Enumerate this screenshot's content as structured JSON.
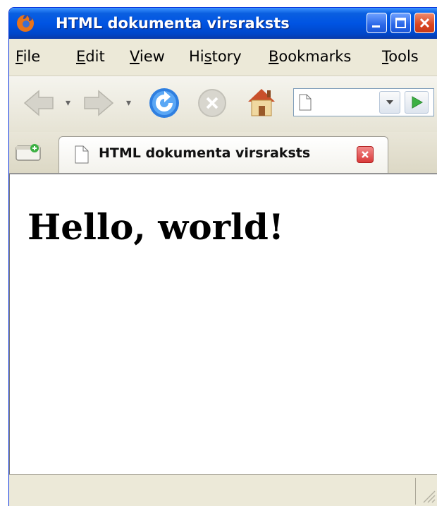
{
  "window": {
    "title": "HTML dokumenta virsraksts"
  },
  "menu": {
    "items": [
      {
        "pre": "",
        "ul": "F",
        "post": "ile"
      },
      {
        "pre": "",
        "ul": "E",
        "post": "dit"
      },
      {
        "pre": "",
        "ul": "V",
        "post": "iew"
      },
      {
        "pre": "Hi",
        "ul": "s",
        "post": "tory"
      },
      {
        "pre": "",
        "ul": "B",
        "post": "ookmarks"
      },
      {
        "pre": "",
        "ul": "T",
        "post": "ools"
      }
    ]
  },
  "navbar": {
    "url_value": "",
    "icons": [
      "back-arrow-icon",
      "forward-arrow-icon",
      "reload-icon",
      "stop-icon",
      "home-icon",
      "page-icon",
      "dropdown-arrow-icon",
      "go-arrow-icon"
    ]
  },
  "tabs": [
    {
      "title": "HTML dokumenta virsraksts",
      "active": true
    }
  ],
  "page": {
    "heading": "Hello, world!"
  },
  "colors": {
    "titlebar": "#0054e3",
    "chrome": "#ece9d8",
    "tab_close": "#d93a3a",
    "go": "#3cb043"
  }
}
